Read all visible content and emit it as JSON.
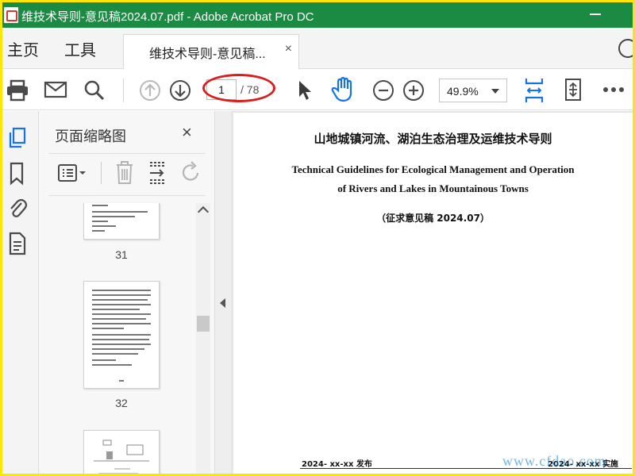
{
  "window": {
    "title": "维技术导则-意见稿2024.07.pdf - Adobe Acrobat Pro DC"
  },
  "nav": {
    "home": "主页",
    "tools": "工具",
    "doc_tab": "维技术导则-意见稿...",
    "close_tab": "×"
  },
  "toolbar": {
    "page_current": "1",
    "page_total": "/ 78",
    "zoom": "49.9%"
  },
  "thumbnails": {
    "header": "页面缩略图",
    "close": "×",
    "pages": [
      {
        "number": "31"
      },
      {
        "number": "32"
      }
    ]
  },
  "document": {
    "title_cn": "山地城镇河流、湖泊生态治理及运维技术导则",
    "title_en_line1": "Technical Guidelines for Ecological Management and Operation",
    "title_en_line2": "of Rivers and Lakes in Mountainous Towns",
    "draft_note": "（征求意见稿 2024.07）",
    "issued": "2024- xx-xx 发布",
    "implemented": "2024- xx-xx 实施"
  },
  "watermark": "www.cfdao.com",
  "colors": {
    "title_bar": "#1b8a43",
    "accent_blue": "#1473e6",
    "highlight_red": "#d62020",
    "frame": "#ffe600"
  }
}
